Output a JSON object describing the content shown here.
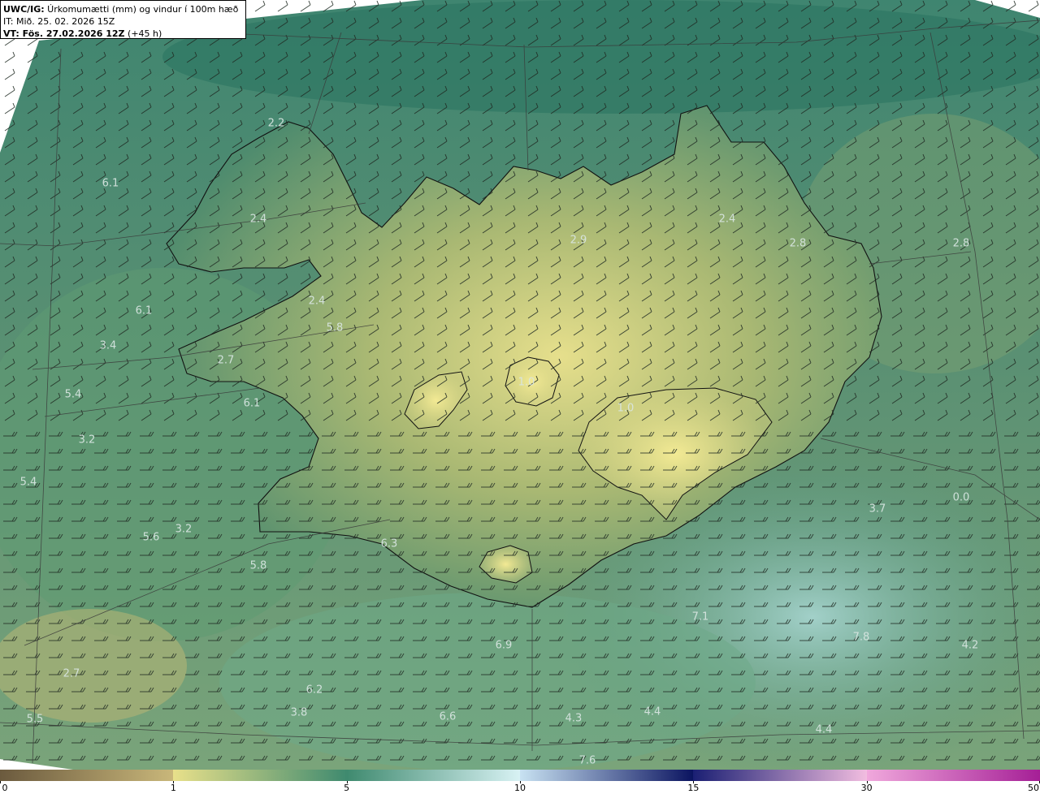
{
  "header": {
    "model_label": "UWC/IG:",
    "field_label": " Úrkomumætti (mm) og vindur í 100m hæð",
    "init_time": "IT: Mið. 25. 02. 2026 15Z",
    "valid_label": "VT: Fös. 27.02.2026 12Z",
    "lead_time": " (+45 h)"
  },
  "colorbar": {
    "ticks": [
      "0",
      "1",
      "5",
      "10",
      "15",
      "30",
      "50"
    ],
    "segments": [
      {
        "from": "#6b5a3e",
        "to": "#c9b77a"
      },
      {
        "from": "#e8e08a",
        "to": "#3f8a6f"
      },
      {
        "from": "#3f8a6f",
        "to": "#d8f2f4"
      },
      {
        "from": "#c8e2f2",
        "to": "#0b1460"
      },
      {
        "from": "#1a1f73",
        "to": "#f2bde0"
      },
      {
        "from": "#f0a8dc",
        "to": "#a51f96"
      }
    ]
  },
  "precip_values": [
    {
      "label": "2.2"
    },
    {
      "label": "6.1"
    },
    {
      "label": "2.4"
    },
    {
      "label": "2.9"
    },
    {
      "label": "2.8"
    },
    {
      "label": "6.1"
    },
    {
      "label": "5.8"
    },
    {
      "label": "2.4"
    },
    {
      "label": "3.4"
    },
    {
      "label": "2.7"
    },
    {
      "label": "5.4"
    },
    {
      "label": "6.1"
    },
    {
      "label": "1.0"
    },
    {
      "label": "1.0"
    },
    {
      "label": "3.2"
    },
    {
      "label": "5.4"
    },
    {
      "label": "3.2"
    },
    {
      "label": "5.6"
    },
    {
      "label": "6.3"
    },
    {
      "label": "5.8"
    },
    {
      "label": "3.7"
    },
    {
      "label": "0.0"
    },
    {
      "label": "7.1"
    },
    {
      "label": "7.8"
    },
    {
      "label": "4.2"
    },
    {
      "label": "6.9"
    },
    {
      "label": "2.7"
    },
    {
      "label": "6.2"
    },
    {
      "label": "5.5"
    },
    {
      "label": "3.8"
    },
    {
      "label": "6.6"
    },
    {
      "label": "4.3"
    },
    {
      "label": "4.4"
    },
    {
      "label": "4.4"
    },
    {
      "label": "7.6"
    },
    {
      "label": "2.8"
    },
    {
      "label": "2.4"
    }
  ],
  "map": {
    "ocean_color": "#2f7a66",
    "land_color": "#b9c27a",
    "outer_region_color": "#ffffff",
    "wind_barbs": "wind-barbs"
  }
}
